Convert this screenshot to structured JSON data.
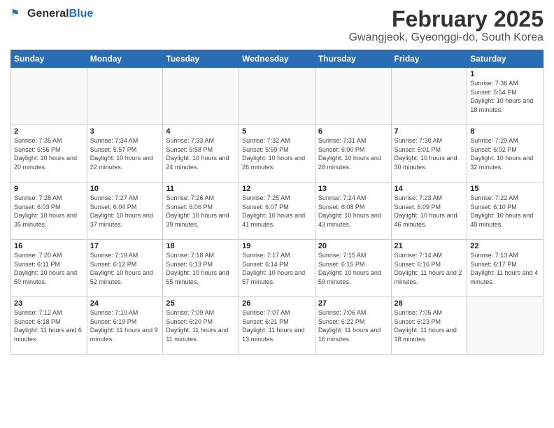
{
  "header": {
    "logo_general": "General",
    "logo_blue": "Blue",
    "title": "February 2025",
    "subtitle": "Gwangjeok, Gyeonggi-do, South Korea"
  },
  "days_of_week": [
    "Sunday",
    "Monday",
    "Tuesday",
    "Wednesday",
    "Thursday",
    "Friday",
    "Saturday"
  ],
  "weeks": [
    [
      {
        "day": "",
        "info": "",
        "empty": true
      },
      {
        "day": "",
        "info": "",
        "empty": true
      },
      {
        "day": "",
        "info": "",
        "empty": true
      },
      {
        "day": "",
        "info": "",
        "empty": true
      },
      {
        "day": "",
        "info": "",
        "empty": true
      },
      {
        "day": "",
        "info": "",
        "empty": true
      },
      {
        "day": "1",
        "info": "Sunrise: 7:36 AM\nSunset: 5:54 PM\nDaylight: 10 hours\nand 18 minutes."
      }
    ],
    [
      {
        "day": "2",
        "info": "Sunrise: 7:35 AM\nSunset: 5:56 PM\nDaylight: 10 hours\nand 20 minutes."
      },
      {
        "day": "3",
        "info": "Sunrise: 7:34 AM\nSunset: 5:57 PM\nDaylight: 10 hours\nand 22 minutes."
      },
      {
        "day": "4",
        "info": "Sunrise: 7:33 AM\nSunset: 5:58 PM\nDaylight: 10 hours\nand 24 minutes."
      },
      {
        "day": "5",
        "info": "Sunrise: 7:32 AM\nSunset: 5:59 PM\nDaylight: 10 hours\nand 26 minutes."
      },
      {
        "day": "6",
        "info": "Sunrise: 7:31 AM\nSunset: 6:00 PM\nDaylight: 10 hours\nand 28 minutes."
      },
      {
        "day": "7",
        "info": "Sunrise: 7:30 AM\nSunset: 6:01 PM\nDaylight: 10 hours\nand 30 minutes."
      },
      {
        "day": "8",
        "info": "Sunrise: 7:29 AM\nSunset: 6:02 PM\nDaylight: 10 hours\nand 32 minutes."
      }
    ],
    [
      {
        "day": "9",
        "info": "Sunrise: 7:28 AM\nSunset: 6:03 PM\nDaylight: 10 hours\nand 35 minutes."
      },
      {
        "day": "10",
        "info": "Sunrise: 7:27 AM\nSunset: 6:04 PM\nDaylight: 10 hours\nand 37 minutes."
      },
      {
        "day": "11",
        "info": "Sunrise: 7:26 AM\nSunset: 6:06 PM\nDaylight: 10 hours\nand 39 minutes."
      },
      {
        "day": "12",
        "info": "Sunrise: 7:25 AM\nSunset: 6:07 PM\nDaylight: 10 hours\nand 41 minutes."
      },
      {
        "day": "13",
        "info": "Sunrise: 7:24 AM\nSunset: 6:08 PM\nDaylight: 10 hours\nand 43 minutes."
      },
      {
        "day": "14",
        "info": "Sunrise: 7:23 AM\nSunset: 6:09 PM\nDaylight: 10 hours\nand 46 minutes."
      },
      {
        "day": "15",
        "info": "Sunrise: 7:22 AM\nSunset: 6:10 PM\nDaylight: 10 hours\nand 48 minutes."
      }
    ],
    [
      {
        "day": "16",
        "info": "Sunrise: 7:20 AM\nSunset: 6:11 PM\nDaylight: 10 hours\nand 50 minutes."
      },
      {
        "day": "17",
        "info": "Sunrise: 7:19 AM\nSunset: 6:12 PM\nDaylight: 10 hours\nand 52 minutes."
      },
      {
        "day": "18",
        "info": "Sunrise: 7:18 AM\nSunset: 6:13 PM\nDaylight: 10 hours\nand 55 minutes."
      },
      {
        "day": "19",
        "info": "Sunrise: 7:17 AM\nSunset: 6:14 PM\nDaylight: 10 hours\nand 57 minutes."
      },
      {
        "day": "20",
        "info": "Sunrise: 7:15 AM\nSunset: 6:15 PM\nDaylight: 10 hours\nand 59 minutes."
      },
      {
        "day": "21",
        "info": "Sunrise: 7:14 AM\nSunset: 6:16 PM\nDaylight: 11 hours\nand 2 minutes."
      },
      {
        "day": "22",
        "info": "Sunrise: 7:13 AM\nSunset: 6:17 PM\nDaylight: 11 hours\nand 4 minutes."
      }
    ],
    [
      {
        "day": "23",
        "info": "Sunrise: 7:12 AM\nSunset: 6:18 PM\nDaylight: 11 hours\nand 6 minutes."
      },
      {
        "day": "24",
        "info": "Sunrise: 7:10 AM\nSunset: 6:19 PM\nDaylight: 11 hours\nand 9 minutes."
      },
      {
        "day": "25",
        "info": "Sunrise: 7:09 AM\nSunset: 6:20 PM\nDaylight: 11 hours\nand 11 minutes."
      },
      {
        "day": "26",
        "info": "Sunrise: 7:07 AM\nSunset: 6:21 PM\nDaylight: 11 hours\nand 13 minutes."
      },
      {
        "day": "27",
        "info": "Sunrise: 7:06 AM\nSunset: 6:22 PM\nDaylight: 11 hours\nand 16 minutes."
      },
      {
        "day": "28",
        "info": "Sunrise: 7:05 AM\nSunset: 6:23 PM\nDaylight: 11 hours\nand 18 minutes."
      },
      {
        "day": "",
        "info": "",
        "empty": true
      }
    ]
  ]
}
